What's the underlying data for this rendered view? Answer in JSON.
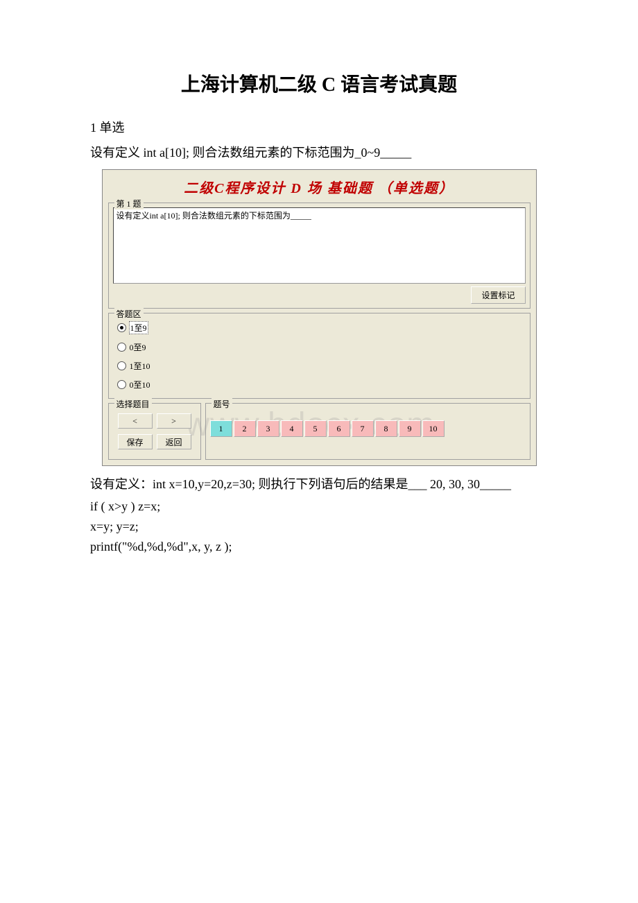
{
  "doc": {
    "title": "上海计算机二级 C 语言考试真题",
    "section1_label": "1 单选",
    "question1_text": "设有定义 int a[10]; 则合法数组元素的下标范围为_0~9_____",
    "question2_text": "设有定义：int x=10,y=20,z=30; 则执行下列语句后的结果是___ 20, 30, 30_____",
    "code_line1": "if ( x>y ) z=x;",
    "code_line2": "x=y; y=z;",
    "code_line3": "printf(\"%d,%d,%d\",x, y, z );"
  },
  "app": {
    "header": "二级C程序设计  D  场  基础题 （单选题）",
    "question_group_legend": "第 1 题",
    "question_body": "设有定义int a[10]; 则合法数组元素的下标范围为_____",
    "mark_button": "设置标记",
    "answer_group_legend": "答题区",
    "options": [
      {
        "label": "1至9",
        "selected": true
      },
      {
        "label": "0至9",
        "selected": false
      },
      {
        "label": "1至10",
        "selected": false
      },
      {
        "label": "0至10",
        "selected": false
      }
    ],
    "nav_legend": "选择题目",
    "nav_prev": "<",
    "nav_next": ">",
    "nav_save": "保存",
    "nav_back": "返回",
    "num_legend": "题号",
    "numbers": [
      "1",
      "2",
      "3",
      "4",
      "5",
      "6",
      "7",
      "8",
      "9",
      "10"
    ],
    "current_number_index": 0,
    "watermark": "www.bdocx.com"
  }
}
